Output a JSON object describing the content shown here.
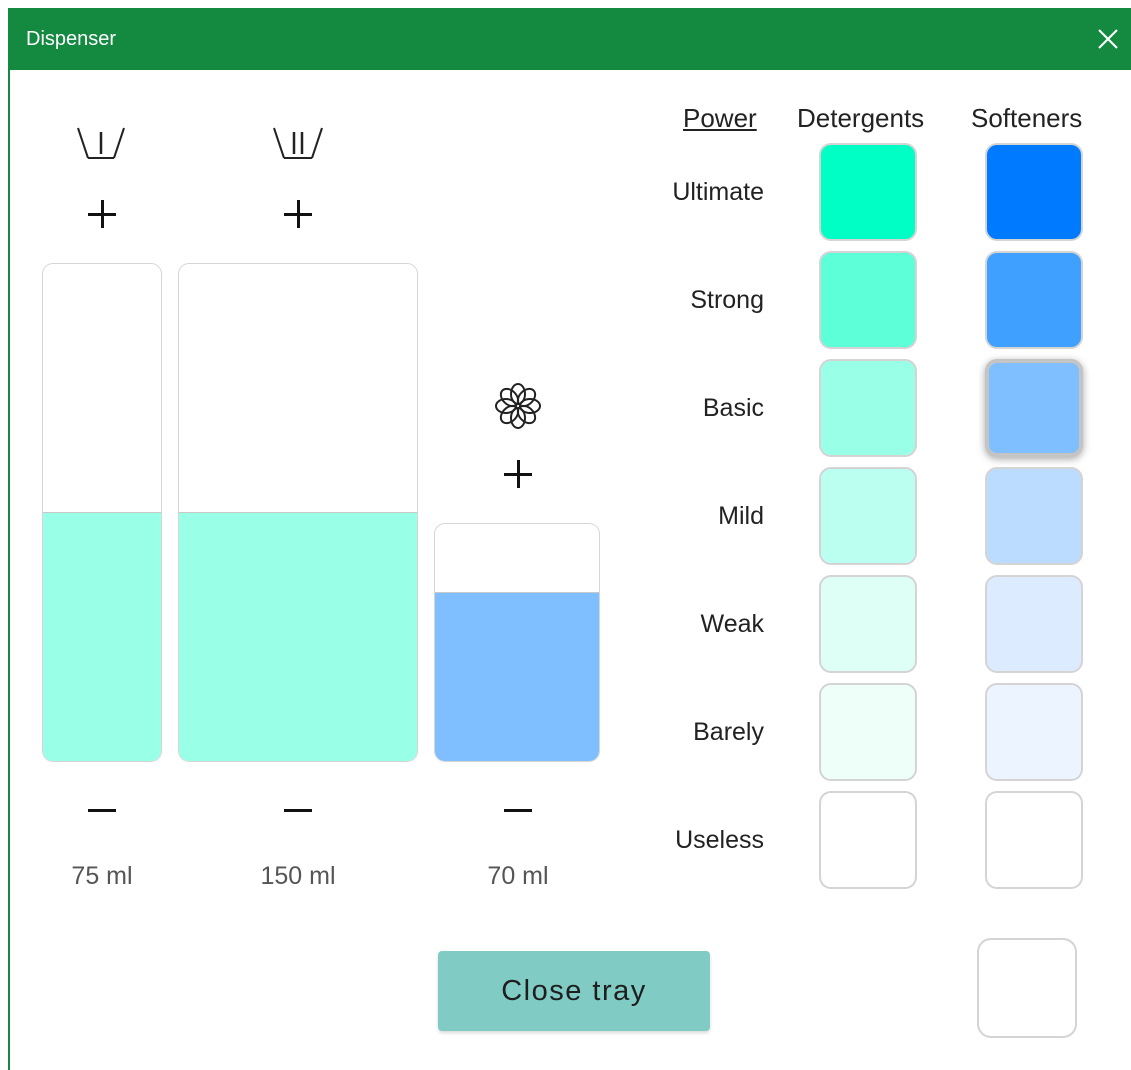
{
  "window": {
    "title": "Dispenser"
  },
  "tanks": [
    {
      "volume": "75 ml",
      "fill_fraction": 0.5,
      "fill_color": "#99ffe6",
      "icon": "compartment-I-icon"
    },
    {
      "volume": "150 ml",
      "fill_fraction": 0.5,
      "fill_color": "#99ffe6",
      "icon": "compartment-II-icon"
    },
    {
      "volume": "70 ml",
      "fill_fraction": 0.71,
      "fill_color": "#80bfff",
      "icon": "flower-icon"
    }
  ],
  "table": {
    "headers": {
      "power": "Power",
      "detergents": "Detergents",
      "softeners": "Softeners"
    },
    "rows": [
      {
        "label": "Ultimate",
        "detergent_color": "#00ffc4",
        "softener_color": "#007bff"
      },
      {
        "label": "Strong",
        "detergent_color": "#5cffd8",
        "softener_color": "#40a0ff"
      },
      {
        "label": "Basic",
        "detergent_color": "#99ffe6",
        "softener_color": "#80bfff"
      },
      {
        "label": "Mild",
        "detergent_color": "#bbfff0",
        "softener_color": "#bbdcff"
      },
      {
        "label": "Weak",
        "detergent_color": "#ddfff5",
        "softener_color": "#dcebff"
      },
      {
        "label": "Barely",
        "detergent_color": "#eefff9",
        "softener_color": "#ecf4ff"
      },
      {
        "label": "Useless",
        "detergent_color": "#ffffff",
        "softener_color": "#ffffff"
      }
    ],
    "selected_softener": "Basic"
  },
  "actions": {
    "close_tray": "Close tray"
  },
  "colors": {
    "titlebar": "#138a40",
    "button": "#80cbc4"
  }
}
